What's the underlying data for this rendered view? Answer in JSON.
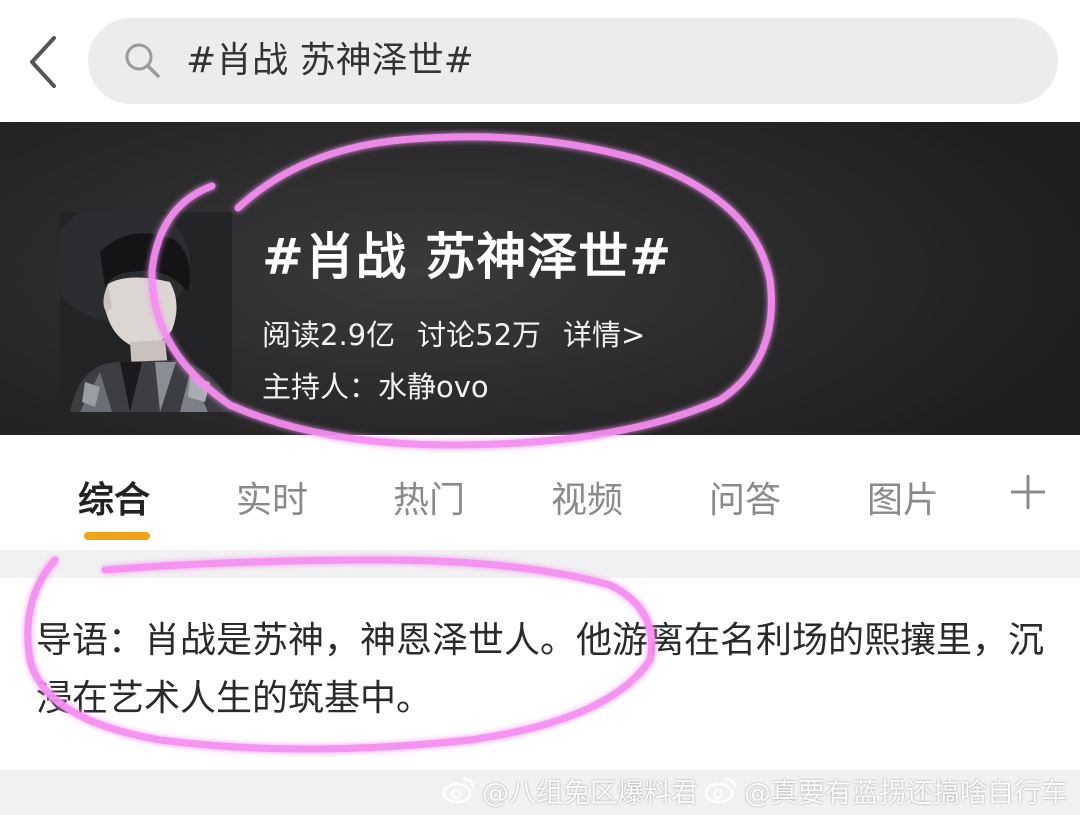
{
  "search": {
    "query": "#肖战 苏神泽世#"
  },
  "topic": {
    "title": "#肖战 苏神泽世#",
    "reads": "阅读2.9亿",
    "discussions": "讨论52万",
    "details_link": "详情>",
    "host": "主持人：水静ovo"
  },
  "tabs": [
    {
      "label": "综合",
      "active": true
    },
    {
      "label": "实时"
    },
    {
      "label": "热门"
    },
    {
      "label": "视频"
    },
    {
      "label": "问答"
    },
    {
      "label": "图片"
    }
  ],
  "intro": {
    "text": "导语：肖战是苏神，神恩泽世人。他游离在名利场的熙攘里，沉浸在艺术人生的筑基中。"
  },
  "watermark": {
    "part1": "@八组兔区爆料君",
    "part2": "@真要有蓝拐还搞啥自行车"
  },
  "colors": {
    "accent_underline": "#f3a316",
    "highlight_marker": "#f58ff0",
    "banner_bg": "#2a2a2b"
  },
  "icons": [
    "back-arrow-icon",
    "search-icon",
    "plus-icon",
    "weibo-logo-icon"
  ]
}
